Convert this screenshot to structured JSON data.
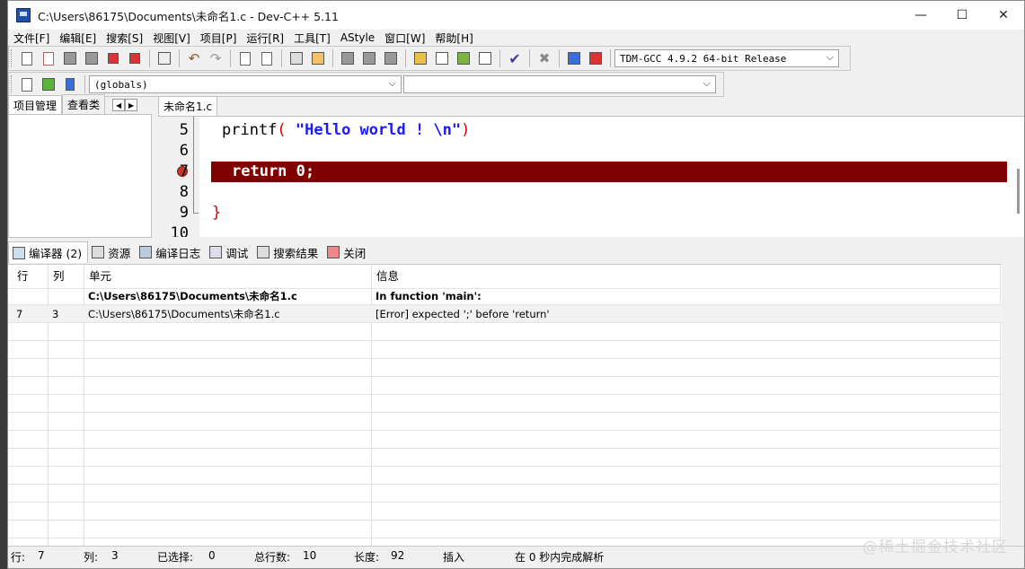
{
  "window": {
    "title": "C:\\Users\\86175\\Documents\\未命名1.c - Dev-C++ 5.11"
  },
  "controls": {
    "minimize": "—",
    "maximize": "☐",
    "close": "✕"
  },
  "menu": [
    "文件[F]",
    "编辑[E]",
    "搜索[S]",
    "视图[V]",
    "项目[P]",
    "运行[R]",
    "工具[T]",
    "AStyle",
    "窗口[W]",
    "帮助[H]"
  ],
  "toolbar": {
    "compiler_select": "TDM-GCC 4.9.2 64-bit Release",
    "scope_select": "(globals)",
    "function_select": ""
  },
  "left_panel": {
    "tabs": [
      "项目管理",
      "查看类"
    ],
    "nav_prev": "◀",
    "nav_next": "▶"
  },
  "editor": {
    "tab": "未命名1.c",
    "lines": [
      {
        "num": "5",
        "fn": "printf",
        "open": "(",
        "str": " \"Hello world ! \\n\"",
        "close": ")"
      },
      {
        "num": "6"
      },
      {
        "num": "7",
        "code": "return 0;",
        "error": true
      },
      {
        "num": "8"
      },
      {
        "num": "9",
        "brace": "}"
      },
      {
        "num": "10"
      }
    ]
  },
  "bottom_tabs": [
    "编译器 (2)",
    "资源",
    "编译日志",
    "调试",
    "搜索结果",
    "关闭"
  ],
  "messages": {
    "headers": {
      "row": "行",
      "col": "列",
      "unit": "单元",
      "info": "信息"
    },
    "rows": [
      {
        "row": "",
        "col": "",
        "unit": "C:\\Users\\86175\\Documents\\未命名1.c",
        "info": "In function 'main':"
      },
      {
        "row": "7",
        "col": "3",
        "unit": "C:\\Users\\86175\\Documents\\未命名1.c",
        "info": "[Error] expected ';' before 'return'"
      }
    ]
  },
  "statusbar": {
    "line_label": "行:",
    "line_value": "7",
    "col_label": "列:",
    "col_value": "3",
    "sel_label": "已选择:",
    "sel_value": "0",
    "total_label": "总行数:",
    "total_value": "10",
    "len_label": "长度:",
    "len_value": "92",
    "mode": "插入",
    "parse": "在 0 秒内完成解析"
  },
  "watermark": "@稀土掘金技术社区"
}
